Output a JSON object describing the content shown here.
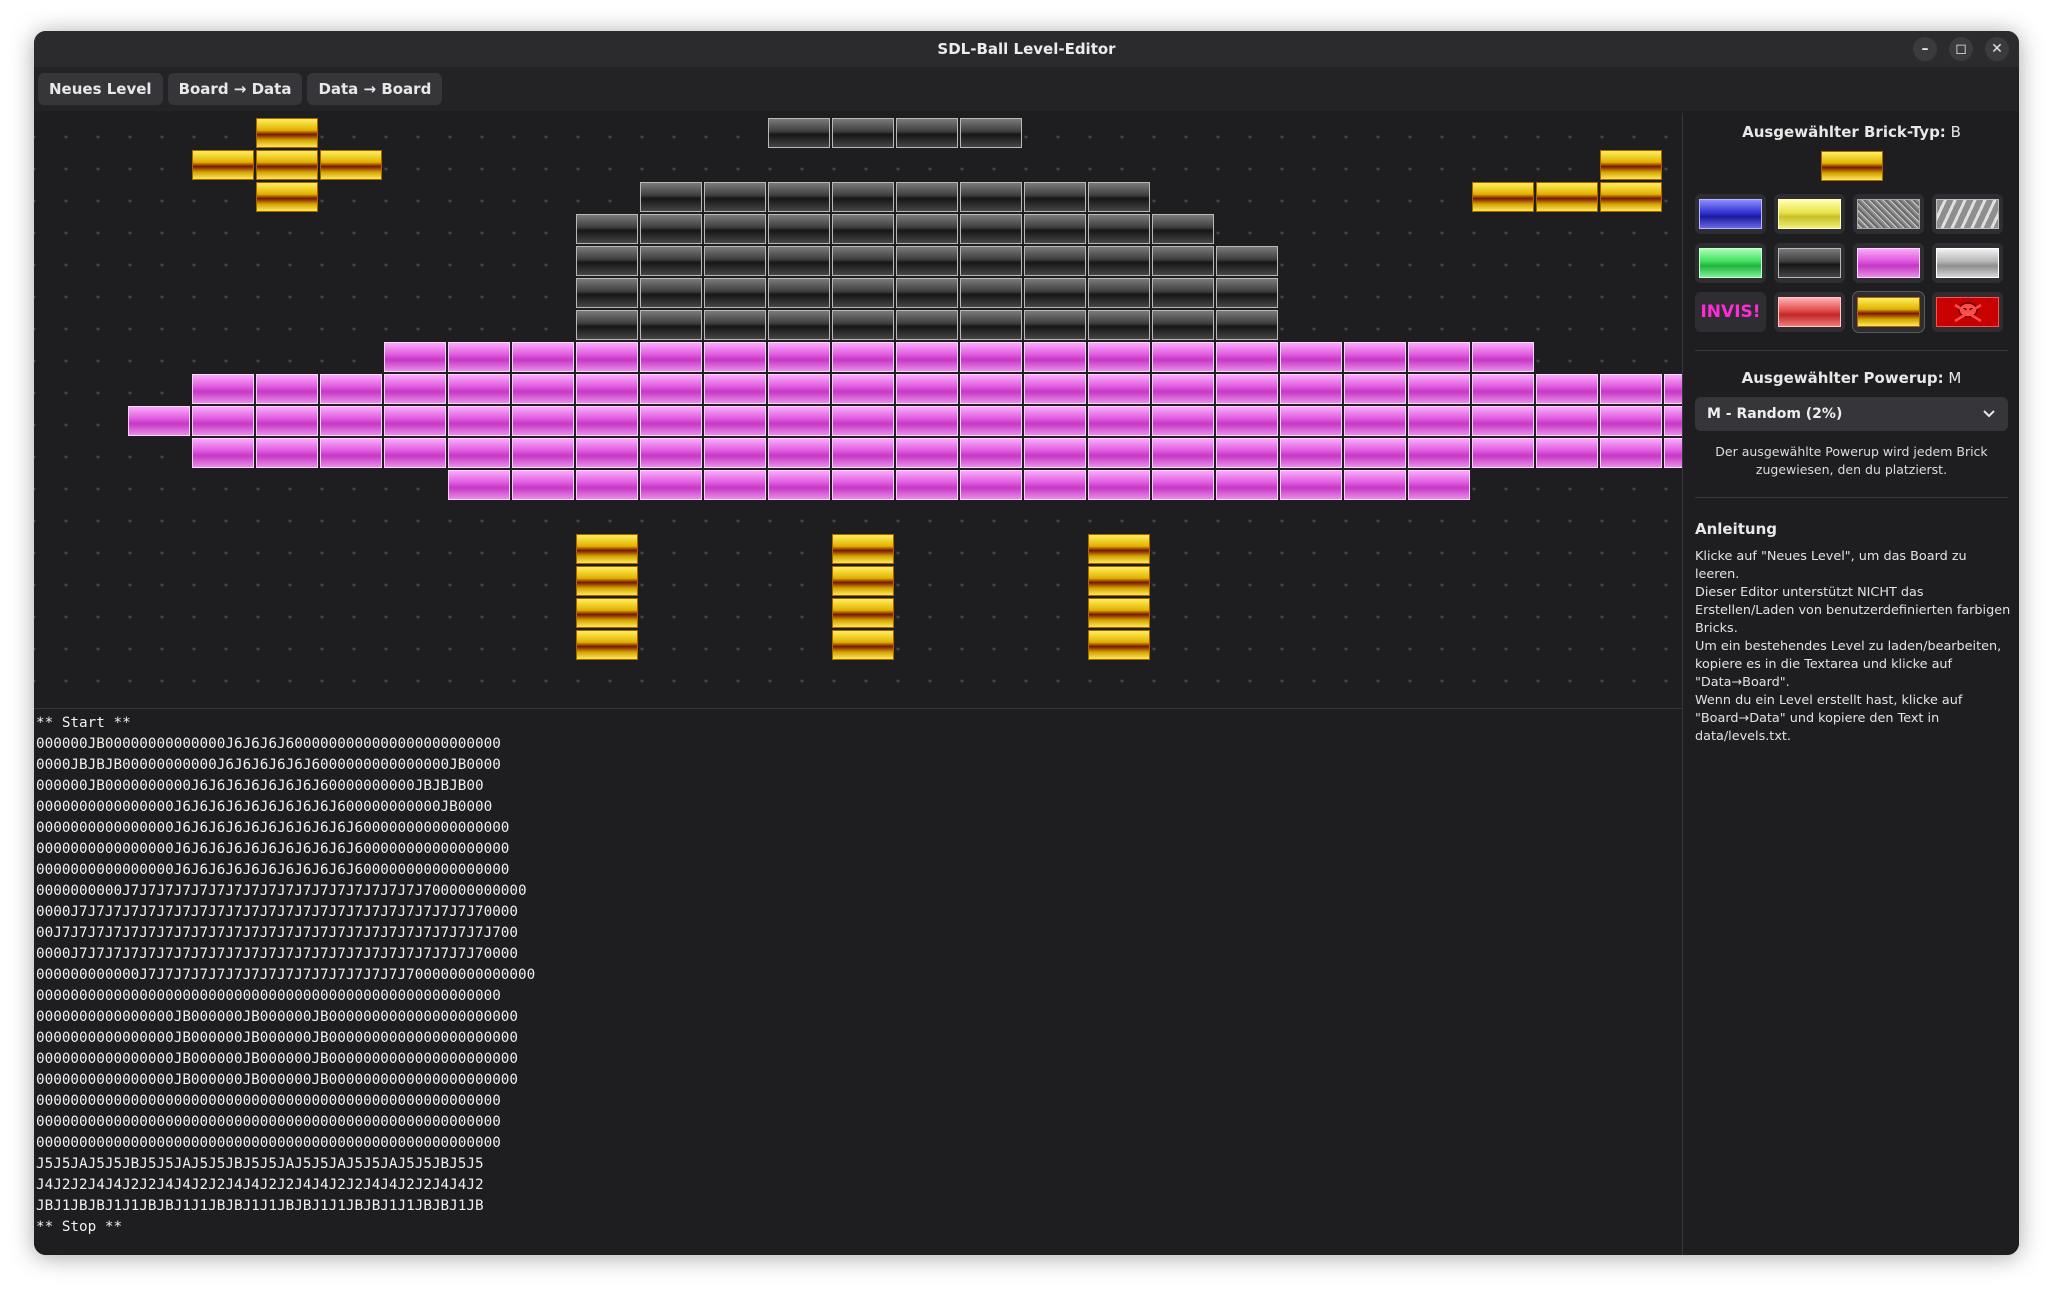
{
  "window": {
    "title": "SDL-Ball Level-Editor",
    "controls": {
      "minimize": "–",
      "maximize": "◻",
      "close": "✕"
    }
  },
  "toolbar": {
    "new_level": "Neues Level",
    "board_to_data": "Board → Data",
    "data_to_board": "Data → Board"
  },
  "board": {
    "rows": [
      "000000JB00000000000000J6J6J6J6000000000000000000000000",
      "0000JBJBJB00000000000J6J6J6J6J6J6000000000000000JB0000",
      "000000JB0000000000J6J6J6J6J6J6J6J60000000000JBJBJB00",
      "0000000000000000J6J6J6J6J6J6J6J6J6J600000000000JB0000",
      "0000000000000000J6J6J6J6J6J6J6J6J6J6J600000000000000000",
      "0000000000000000J6J6J6J6J6J6J6J6J6J6J600000000000000000",
      "0000000000000000J6J6J6J6J6J6J6J6J6J6J600000000000000000",
      "0000000000J7J7J7J7J7J7J7J7J7J7J7J7J7J7J7J7J7J700000000000",
      "0000J7J7J7J7J7J7J7J7J7J7J7J7J7J7J7J7J7J7J7J7J7J7J7J70000",
      "00J7J7J7J7J7J7J7J7J7J7J7J7J7J7J7J7J7J7J7J7J7J7J7J7J7J700",
      "0000J7J7J7J7J7J7J7J7J7J7J7J7J7J7J7J7J7J7J7J7J7J7J7J70000",
      "000000000000J7J7J7J7J7J7J7J7J7J7J7J7J7J7J7J700000000000000",
      "000000000000000000000000000000000000000000000000000000",
      "0000000000000000JB000000JB000000JB0000000000000000000000",
      "0000000000000000JB000000JB000000JB0000000000000000000000",
      "0000000000000000JB000000JB000000JB0000000000000000000000",
      "0000000000000000JB000000JB000000JB0000000000000000000000"
    ]
  },
  "code_text": "** Start **\n000000JB00000000000000J6J6J6J6000000000000000000000000\n0000JBJBJB00000000000J6J6J6J6J6J6000000000000000JB0000\n000000JB0000000000J6J6J6J6J6J6J6J60000000000JBJBJB00\n0000000000000000J6J6J6J6J6J6J6J6J6J600000000000JB0000\n0000000000000000J6J6J6J6J6J6J6J6J6J6J600000000000000000\n0000000000000000J6J6J6J6J6J6J6J6J6J6J600000000000000000\n0000000000000000J6J6J6J6J6J6J6J6J6J6J600000000000000000\n0000000000J7J7J7J7J7J7J7J7J7J7J7J7J7J7J7J7J7J700000000000\n0000J7J7J7J7J7J7J7J7J7J7J7J7J7J7J7J7J7J7J7J7J7J7J7J70000\n00J7J7J7J7J7J7J7J7J7J7J7J7J7J7J7J7J7J7J7J7J7J7J7J7J7J700\n0000J7J7J7J7J7J7J7J7J7J7J7J7J7J7J7J7J7J7J7J7J7J7J7J70000\n000000000000J7J7J7J7J7J7J7J7J7J7J7J7J7J7J7J700000000000000\n000000000000000000000000000000000000000000000000000000\n0000000000000000JB000000JB000000JB0000000000000000000000\n0000000000000000JB000000JB000000JB0000000000000000000000\n0000000000000000JB000000JB000000JB0000000000000000000000\n0000000000000000JB000000JB000000JB0000000000000000000000\n000000000000000000000000000000000000000000000000000000\n000000000000000000000000000000000000000000000000000000\n000000000000000000000000000000000000000000000000000000\nJ5J5JAJ5J5JBJ5J5JAJ5J5JBJ5J5JAJ5J5JAJ5J5JAJ5J5JBJ5J5\nJ4J2J2J4J4J2J2J4J4J2J2J4J4J2J2J4J4J2J2J4J4J2J2J4J4J2\nJBJ1JBJBJ1J1JBJBJ1J1JBJBJ1J1JBJBJ1J1JBJBJ1J1JBJBJ1JB\n** Stop **",
  "sidebar": {
    "brick_type_label": "Ausgewählter Brick-Typ:",
    "brick_type_value": "B",
    "palette": [
      {
        "name": "blue-brick"
      },
      {
        "name": "yellow-brick"
      },
      {
        "name": "noise-brick"
      },
      {
        "name": "striped-brick"
      },
      {
        "name": "green-brick"
      },
      {
        "name": "dark-brick"
      },
      {
        "name": "magenta-brick"
      },
      {
        "name": "silver-brick"
      },
      {
        "name": "invisible-brick",
        "text": "INVIS!"
      },
      {
        "name": "red-brick"
      },
      {
        "name": "gold-brick"
      },
      {
        "name": "explosive-brick",
        "icon": "skull-icon"
      }
    ],
    "powerup_label": "Ausgewählter Powerup:",
    "powerup_value": "M",
    "powerup_select": "M - Random (2%)",
    "powerup_hint": "Der ausgewählte Powerup wird jedem Brick zugewiesen, den du platzierst.",
    "instructions_title": "Anleitung",
    "instructions": [
      "Klicke auf \"Neues Level\", um das Board zu leeren.",
      "Dieser Editor unterstützt NICHT das Erstellen/Laden von benutzerdefinierten farbigen Bricks.",
      "Um ein bestehendes Level zu laden/bearbeiten, kopiere es in die Textarea und klicke auf \"Data→Board\".",
      "Wenn du ein Level erstellt hast, klicke auf \"Board→Data\" und kopiere den Text in data/levels.txt."
    ]
  }
}
